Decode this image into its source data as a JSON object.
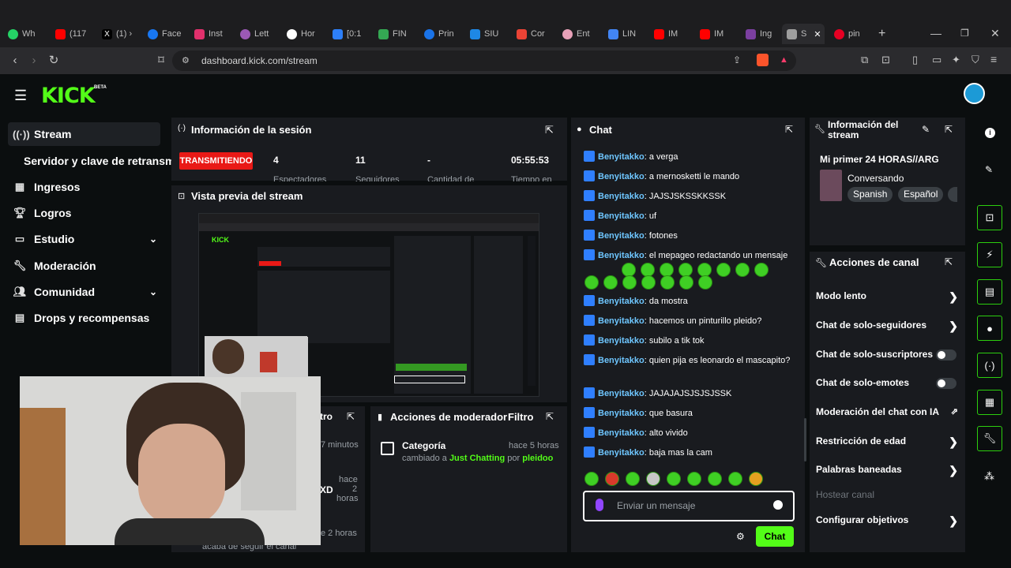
{
  "browser": {
    "tabs": [
      {
        "label": "Wh",
        "color": "#25d366"
      },
      {
        "label": "(117",
        "color": "#ff0000"
      },
      {
        "label": "(1) ›",
        "color": "#000000"
      },
      {
        "label": "Face",
        "color": "#1877f2"
      },
      {
        "label": "Inst",
        "color": "#e1306c"
      },
      {
        "label": "Lett",
        "color": "#9b59b6"
      },
      {
        "label": "Hor",
        "color": "#ffffff"
      },
      {
        "label": "[0:1",
        "color": "#2d7ff9"
      },
      {
        "label": "FIN",
        "color": "#34a853"
      },
      {
        "label": "Prin",
        "color": "#1a73e8"
      },
      {
        "label": "SIU",
        "color": "#1e88e5"
      },
      {
        "label": "Cor",
        "color": "#ea4335"
      },
      {
        "label": "Ent",
        "color": "#e8a1b8"
      },
      {
        "label": "LIN",
        "color": "#4285f4"
      },
      {
        "label": "IM",
        "color": "#ff0000"
      },
      {
        "label": "IM",
        "color": "#ff0000"
      },
      {
        "label": "Ing",
        "color": "#7b3fa0"
      },
      {
        "label": "S",
        "color": "#9e9e9e"
      },
      {
        "label": "pin",
        "color": "#e60023"
      }
    ],
    "url": "dashboard.kick.com/stream"
  },
  "header": {
    "logo": "KICK",
    "beta": "BETA"
  },
  "sidebar": {
    "items": [
      {
        "label": "Stream",
        "icon": "broadcast-icon"
      },
      {
        "label": "Servidor y clave de retransm"
      },
      {
        "label": "Ingresos",
        "icon": "bars-icon"
      },
      {
        "label": "Logros",
        "icon": "trophy-icon"
      },
      {
        "label": "Estudio",
        "icon": "screen-icon"
      },
      {
        "label": "Moderación",
        "icon": "wrench-icon"
      },
      {
        "label": "Comunidad",
        "icon": "people-icon"
      },
      {
        "label": "Drops y recompensas",
        "icon": "chart-icon"
      }
    ]
  },
  "session": {
    "title": "Información de la sesión",
    "status": "TRANSMITIENDO",
    "viewers": "4",
    "viewers_label": "Espectadores",
    "followers": "11",
    "followers_label": "Seguidores",
    "duration_placeholder": "-",
    "duration_label": "Cantidad de",
    "time": "05:55:53",
    "time_label": "Tiempo en"
  },
  "preview": {
    "title": "Vista previa del stream"
  },
  "left_overlay": {
    "label1": "tro",
    "label2": "7 minutos",
    "xd": "XD",
    "hace": "hace",
    "dos": "2",
    "horas": "horas",
    "dos_horas": "e 2 horas",
    "follow": "acaba de seguir el canal"
  },
  "mod_actions": {
    "title": "Acciones de moderador",
    "filter": "Filtro",
    "item_title": "Categoría",
    "item_time": "hace 5 horas",
    "item_desc_prefix": "cambiado a",
    "item_category": "Just Chatting",
    "item_by": "por",
    "item_user": "pleidoo"
  },
  "chat": {
    "title": "Chat",
    "messages": [
      {
        "user": "Benyitakko",
        "text": "a verga"
      },
      {
        "user": "Benyitakko",
        "text": "a mernosketti le mando"
      },
      {
        "user": "Benyitakko",
        "text": "JAJSJSKSSKKSSK"
      },
      {
        "user": "Benyitakko",
        "text": "uf"
      },
      {
        "user": "Benyitakko",
        "text": "fotones"
      },
      {
        "user": "Benyitakko",
        "text": "el mepageo redactando un mensaje"
      },
      {
        "user": "Benyitakko",
        "text": "da mostra"
      },
      {
        "user": "Benyitakko",
        "text": "hacemos un pinturillo pleido?"
      },
      {
        "user": "Benyitakko",
        "text": "subilo a tik tok"
      },
      {
        "user": "Benyitakko",
        "text": "quien pija es leonardo el mascapito?"
      },
      {
        "user": "Benyitakko",
        "text": "JAJAJAJSJSJSJSSK"
      },
      {
        "user": "Benyitakko",
        "text": "que basura"
      },
      {
        "user": "Benyitakko",
        "text": "alto vivido"
      },
      {
        "user": "Benyitakko",
        "text": "baja mas la cam"
      }
    ],
    "input_placeholder": "Enviar un mensaje",
    "send_label": "Chat"
  },
  "stream_info": {
    "title": "Información del stream",
    "stream_title": "Mi primer 24 HORAS//ARG",
    "category": "Conversando",
    "tags": [
      "Spanish",
      "Español"
    ]
  },
  "channel_actions": {
    "title": "Acciones de canal",
    "items": [
      {
        "label": "Modo lento",
        "control": "chevron"
      },
      {
        "label": "Chat de solo-seguidores",
        "control": "chevron"
      },
      {
        "label": "Chat de solo-suscriptores",
        "control": "toggle"
      },
      {
        "label": "Chat de solo-emotes",
        "control": "toggle"
      },
      {
        "label": "Moderación del chat con IA",
        "control": "external"
      },
      {
        "label": "Restricción de edad",
        "control": "chevron"
      },
      {
        "label": "Palabras baneadas",
        "control": "chevron"
      },
      {
        "label": "Hostear canal",
        "control": "none"
      },
      {
        "label": "Configurar objetivos",
        "control": "chevron"
      }
    ]
  }
}
